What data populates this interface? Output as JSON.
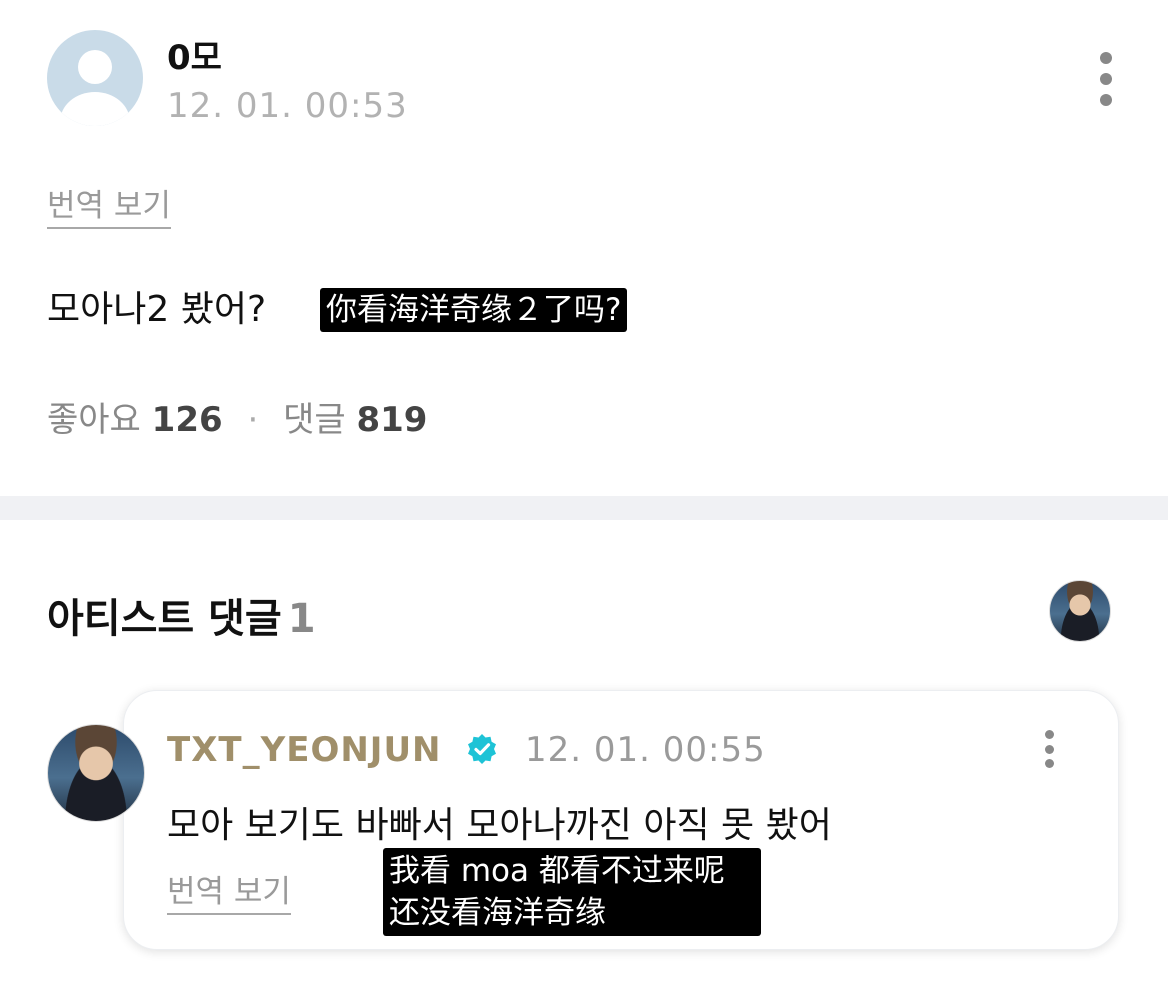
{
  "post": {
    "author": "0모",
    "timestamp": "12. 01. 00:53",
    "translate_label": "번역 보기",
    "body": "모아나2 봤어?",
    "caption": "你看海洋奇缘２了吗?",
    "likes_label": "좋아요",
    "likes_count": "126",
    "separator": "·",
    "comments_label": "댓글",
    "comments_count": "819"
  },
  "artist_section": {
    "title": "아티스트 댓글",
    "count": "1"
  },
  "comment": {
    "author": "TXT_YEONJUN",
    "verified_icon": "verified-badge-icon",
    "timestamp": "12. 01. 00:55",
    "body": "모아 보기도 바빠서 모아나까진 아직 못 봤어",
    "translate_label": "번역 보기",
    "caption_line1": "我看 moa 都看不过来呢",
    "caption_line2": "还没看海洋奇缘"
  },
  "colors": {
    "author_gold": "#a08f6a",
    "verified": "#1ec3d6",
    "muted": "#9a9a9a",
    "divider": "#f0f1f4"
  }
}
